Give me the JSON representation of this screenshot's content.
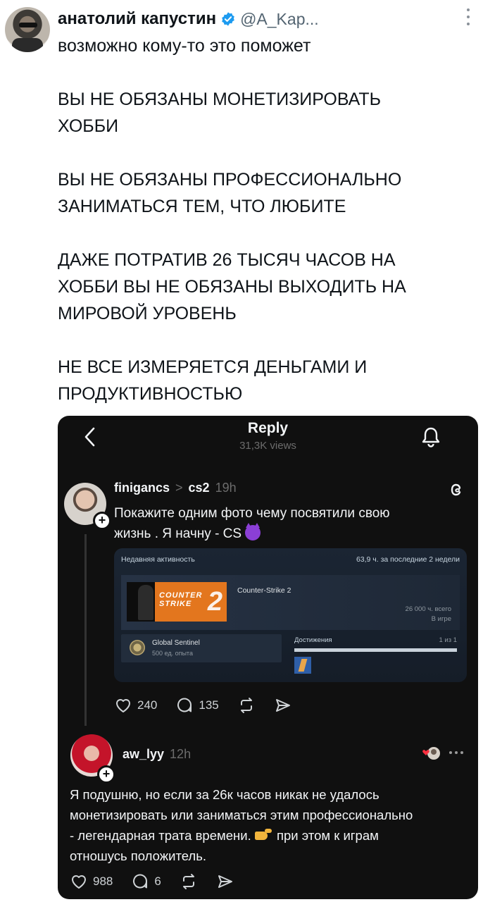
{
  "tweet": {
    "author_name": "анатолий капустин",
    "handle": "@A_Kap...",
    "paragraphs": [
      [
        "возможно кому-то это поможет"
      ],
      [
        "ВЫ НЕ ОБЯЗАНЫ МОНЕТИЗИРОВАТЬ",
        "ХОББИ"
      ],
      [
        "ВЫ НЕ ОБЯЗАНЫ ПРОФЕССИОНАЛЬНО",
        "ЗАНИМАТЬСЯ ТЕМ, ЧТО ЛЮБИТЕ"
      ],
      [
        "ДАЖЕ ПОТРАТИВ 26 ТЫСЯЧ ЧАСОВ НА",
        "ХОББИ ВЫ НЕ ОБЯЗАНЫ ВЫХОДИТЬ НА",
        "МИРОВОЙ УРОВЕНЬ"
      ],
      [
        "НЕ ВСЕ ИЗМЕРЯЕТСЯ ДЕНЬГАМИ И",
        "ПРОДУКТИВНОСТЬЮ"
      ]
    ]
  },
  "screenshot": {
    "title": "Reply",
    "views": "31,3K views",
    "post1": {
      "username": "finigancs",
      "separator": ">",
      "topic": "cs2",
      "time": "19h",
      "text_line1": "Покажите одним фото чему посвятили свою",
      "text_line2": "жизнь . Я начну - CS",
      "likes": "240",
      "comments": "135"
    },
    "steam": {
      "header_left": "Недавняя активность",
      "header_right": "63,9 ч. за последние 2 недели",
      "game_name": "Counter-Strike 2",
      "logo_text": "COUNTER STRIKE",
      "logo_number": "2",
      "hours_total": "26 000 ч. всего",
      "in_game": "В игре",
      "achievement_name": "Global Sentinel",
      "achievement_xp": "500 ед. опыта",
      "achievements_label": "Достижения",
      "achievements_count": "1 из 1",
      "achievements_progress": 1.0
    },
    "post2": {
      "username": "aw_lyy",
      "time": "12h",
      "text_line1": "Я подушню, но если за 26к часов никак не удалось",
      "text_line2": "монетизировать или заниматься этим профессионально",
      "text_line3a": "- легендарная трата времени.",
      "text_line3b": "при этом к играм",
      "text_line4": "отношусь положитель.",
      "likes": "988",
      "comments": "6"
    }
  },
  "colors": {
    "verified": "#1d9bf0",
    "threads_bg": "#101010",
    "steam_bg": "#1b2533",
    "cs_orange": "#e3761e"
  },
  "icons": [
    "verified-icon",
    "more-icon",
    "back-chevron-icon",
    "bell-icon",
    "threads-logo-icon",
    "heart-icon",
    "comment-icon",
    "repost-icon",
    "share-icon"
  ]
}
